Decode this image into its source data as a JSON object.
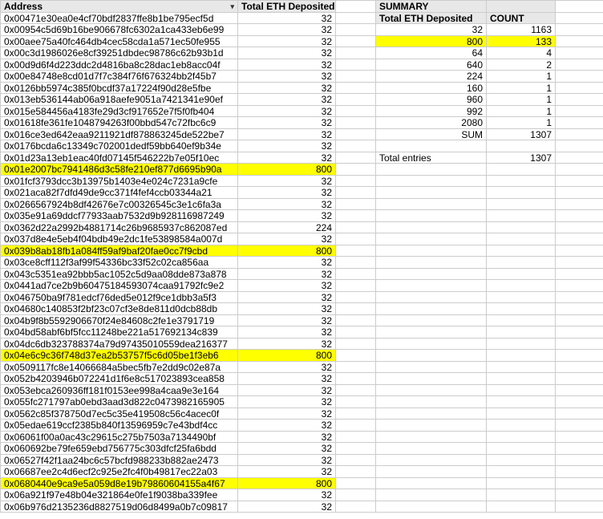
{
  "headers": {
    "address": "Address",
    "eth_dep": "Total ETH Deposited",
    "summary": "SUMMARY",
    "count": "COUNT",
    "sum": "SUM",
    "total_entries": "Total entries"
  },
  "summary": {
    "rows": [
      {
        "eth": 32,
        "count": 1163,
        "hl": false
      },
      {
        "eth": 800,
        "count": 133,
        "hl": true
      },
      {
        "eth": 64,
        "count": 4,
        "hl": false
      },
      {
        "eth": 640,
        "count": 2,
        "hl": false
      },
      {
        "eth": 224,
        "count": 1,
        "hl": false
      },
      {
        "eth": 160,
        "count": 1,
        "hl": false
      },
      {
        "eth": 960,
        "count": 1,
        "hl": false
      },
      {
        "eth": 992,
        "count": 1,
        "hl": false
      },
      {
        "eth": 2080,
        "count": 1,
        "hl": false
      }
    ],
    "sum_count": 1307,
    "total_entries_count": 1307
  },
  "chart_data": {
    "type": "table",
    "columns": [
      "Address",
      "Total ETH Deposited"
    ],
    "rows": [
      {
        "addr": "0x00471e30ea0e4cf70bdf2837ffe8b1be795ecf5d",
        "eth": 32,
        "hl": false
      },
      {
        "addr": "0x00954c5d69b16be906678fc6302a1ca433eb6e99",
        "eth": 32,
        "hl": false
      },
      {
        "addr": "0x00aee75a40fc464db4cec58cda1a571ec50fe955",
        "eth": 32,
        "hl": false
      },
      {
        "addr": "0x00c3d1986026e8cf39251dbdec98786c62b93b1d",
        "eth": 32,
        "hl": false
      },
      {
        "addr": "0x00d9d6f4d223ddc2d4816ba8c28dac1eb8acc04f",
        "eth": 32,
        "hl": false
      },
      {
        "addr": "0x00e84748e8cd01d7f7c384f76f676324bb2f45b7",
        "eth": 32,
        "hl": false
      },
      {
        "addr": "0x0126bb5974c385f0bcdf37a17224f90d28e5fbe",
        "eth": 32,
        "hl": false
      },
      {
        "addr": "0x013eb536144ab06a918aefe9051a7421341e90ef",
        "eth": 32,
        "hl": false
      },
      {
        "addr": "0x015e584456a4183fe29d3cf917652e7f5f0fb404",
        "eth": 32,
        "hl": false
      },
      {
        "addr": "0x01618fe361fe1048794263f00bbd547c72fbc6c9",
        "eth": 32,
        "hl": false
      },
      {
        "addr": "0x016ce3ed642eaa9211921df878863245de522be7",
        "eth": 32,
        "hl": false
      },
      {
        "addr": "0x0176bcda6c13349c702001dedf59bb640ef9b34e",
        "eth": 32,
        "hl": false
      },
      {
        "addr": "0x01d23a13eb1eac40fd07145f546222b7e05f10ec",
        "eth": 32,
        "hl": false
      },
      {
        "addr": "0x01e2007bc7941486d3c58fe210ef877d6695b90a",
        "eth": 800,
        "hl": true
      },
      {
        "addr": "0x01fcf3793dcc3b13975b1403e4e024c7231a9cfe",
        "eth": 32,
        "hl": false
      },
      {
        "addr": "0x021aca82f7dfd49de9cc371f4fef4ccb03344a21",
        "eth": 32,
        "hl": false
      },
      {
        "addr": "0x0266567924b8df42676e7c00326545c3e1c6fa3a",
        "eth": 32,
        "hl": false
      },
      {
        "addr": "0x035e91a69ddcf77933aab7532d9b928116987249",
        "eth": 32,
        "hl": false
      },
      {
        "addr": "0x0362d22a2992b4881714c26b9685937c862087ed",
        "eth": 224,
        "hl": false
      },
      {
        "addr": "0x037d8e4e5eb4f04bdb49e2dc1fe53898584a007d",
        "eth": 32,
        "hl": false
      },
      {
        "addr": "0x039b8ab18fb1a084ff59af9baf20fae0cc7f9cbd",
        "eth": 800,
        "hl": true
      },
      {
        "addr": "0x03ce8cff112f3af99f54336bc33f52c02ca856aa",
        "eth": 32,
        "hl": false
      },
      {
        "addr": "0x043c5351ea92bbb5ac1052c5d9aa08dde873a878",
        "eth": 32,
        "hl": false
      },
      {
        "addr": "0x0441ad7ce2b9b60475184593074caa91792fc9e2",
        "eth": 32,
        "hl": false
      },
      {
        "addr": "0x046750ba9f781edcf76ded5e012f9ce1dbb3a5f3",
        "eth": 32,
        "hl": false
      },
      {
        "addr": "0x04680c140853f2bf23c07cf3e8de811d0dcb88db",
        "eth": 32,
        "hl": false
      },
      {
        "addr": "0x04b9f8b5592906670f24e84608c2fe1e3791719",
        "eth": 32,
        "hl": false
      },
      {
        "addr": "0x04bd58abf6bf5fcc11248be221a517692134c839",
        "eth": 32,
        "hl": false
      },
      {
        "addr": "0x04dc6db323788374a79d97435010559dea216377",
        "eth": 32,
        "hl": false
      },
      {
        "addr": "0x04e6c9c36f748d37ea2b53757f5c6d05be1f3eb6",
        "eth": 800,
        "hl": true
      },
      {
        "addr": "0x0509117fc8e14066684a5bec5fb7e2dd9c02e87a",
        "eth": 32,
        "hl": false
      },
      {
        "addr": "0x052b4203946b072241d1f6e8c517023893cea858",
        "eth": 32,
        "hl": false
      },
      {
        "addr": "0x053ebca260936ff181f0153ee998a4caa9e3e164",
        "eth": 32,
        "hl": false
      },
      {
        "addr": "0x055fc271797ab0ebd3aad3d822c0473982165905",
        "eth": 32,
        "hl": false
      },
      {
        "addr": "0x0562c85f378750d7ec5c35e419508c56c4acec0f",
        "eth": 32,
        "hl": false
      },
      {
        "addr": "0x05edae619ccf2385b840f13596959c7e43bdf4cc",
        "eth": 32,
        "hl": false
      },
      {
        "addr": "0x06061f00a0ac43c29615c275b7503a7134490bf",
        "eth": 32,
        "hl": false
      },
      {
        "addr": "0x060692be79fe659ebd756775c303dfcf25fa6bdd",
        "eth": 32,
        "hl": false
      },
      {
        "addr": "0x06527f42f1aa24bc6c57bcfd988233b882ae2473",
        "eth": 32,
        "hl": false
      },
      {
        "addr": "0x06687ee2c4d6ecf2c925e2fc4f0b49817ec22a03",
        "eth": 32,
        "hl": false
      },
      {
        "addr": "0x0680440e9ca9e5a059d8e19b79860604155a4f67",
        "eth": 800,
        "hl": true
      },
      {
        "addr": "0x06a921f97e48b04e321864e0fe1f9038ba339fee",
        "eth": 32,
        "hl": false
      },
      {
        "addr": "0x06b976d2135236d8827519d06d8499a0b7c09817",
        "eth": 32,
        "hl": false
      }
    ]
  }
}
